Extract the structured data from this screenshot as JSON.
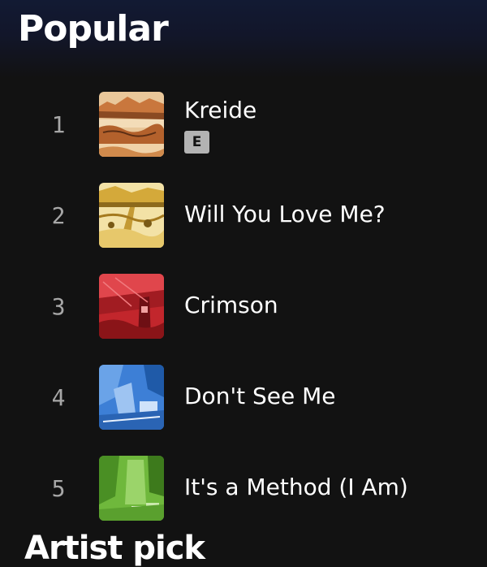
{
  "section": {
    "title": "Popular"
  },
  "tracks": [
    {
      "rank": "1",
      "name": "Kreide",
      "explicit_badge": "E"
    },
    {
      "rank": "2",
      "name": "Will You Love Me?"
    },
    {
      "rank": "3",
      "name": "Crimson"
    },
    {
      "rank": "4",
      "name": "Don't See Me"
    },
    {
      "rank": "5",
      "name": "It's a Method (I Am)"
    }
  ],
  "next_section": {
    "title": "Artist pick"
  },
  "colors": {
    "background": "#121212",
    "header_gradient_top": "#121a33",
    "rank_text": "#a7a7a7",
    "explicit_badge": "#b3b3b3"
  }
}
